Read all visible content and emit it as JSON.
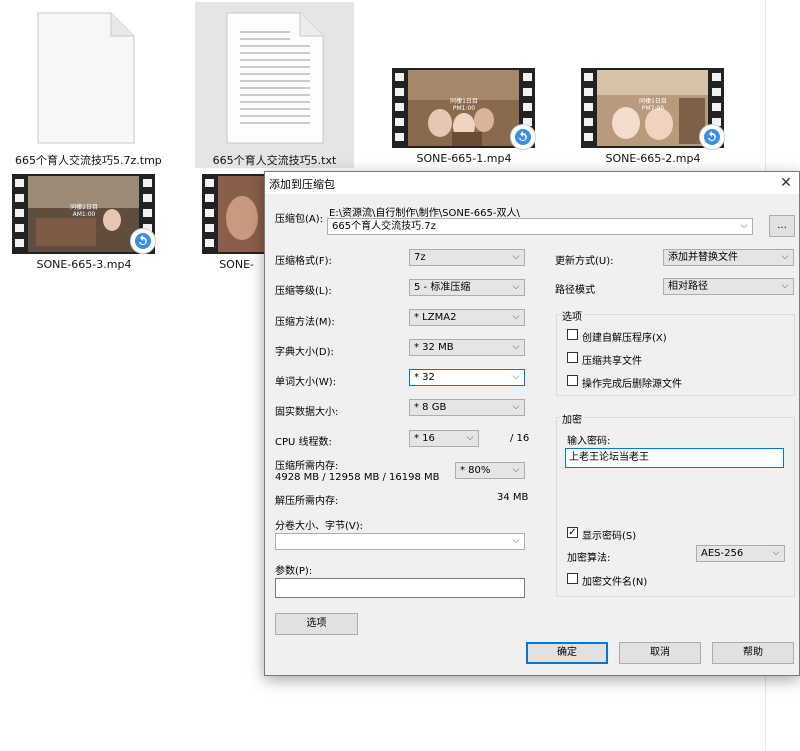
{
  "explorer": {
    "files": [
      {
        "name": "665个育人交流技巧5.7z.tmp",
        "type": "doc-blank"
      },
      {
        "name": "665个育人交流技巧5.txt",
        "type": "doc-lines"
      },
      {
        "name": "SONE-665-1.mp4",
        "type": "video",
        "overlay": "同棲1日目 PM1:00"
      },
      {
        "name": "SONE-665-2.mp4",
        "type": "video",
        "overlay": "同棲1日目 PM7:00"
      },
      {
        "name": "SONE-665-3.mp4",
        "type": "video",
        "overlay": "同棲2日目 AM1:00"
      },
      {
        "name": "SONE-",
        "type": "video-partial"
      }
    ]
  },
  "dialog": {
    "title": "添加到压缩包",
    "archive_label": "压缩包(A):",
    "archive_path": "E:\\资源流\\自行制作\\制作\\SONE-665-双人\\",
    "archive_name": "665个育人交流技巧.7z",
    "browse_label": "...",
    "format_label": "压缩格式(F):",
    "format_value": "7z",
    "level_label": "压缩等级(L):",
    "level_value": "5 - 标准压缩",
    "method_label": "压缩方法(M):",
    "method_value": "* LZMA2",
    "dict_label": "字典大小(D):",
    "dict_value": "* 32 MB",
    "word_label": "单词大小(W):",
    "word_value": "* 32",
    "solid_label": "固实数据大小:",
    "solid_value": "* 8 GB",
    "cpu_label": "CPU 线程数:",
    "cpu_value": "* 16",
    "cpu_total": "/ 16",
    "mem_label": "压缩所需内存:",
    "mem_detail": "4928 MB / 12958 MB / 16198 MB",
    "mem_value": "* 80%",
    "decomp_label": "解压所需内存:",
    "decomp_value": "34 MB",
    "split_label": "分卷大小、字节(V):",
    "split_value": "",
    "params_label": "参数(P):",
    "params_value": "",
    "options_button": "选项",
    "update_label": "更新方式(U):",
    "update_value": "添加并替换文件",
    "path_label": "路径模式",
    "path_value": "相对路径",
    "options_group": "选项",
    "opt_sfx": "创建自解压程序(X)",
    "opt_shared": "压缩共享文件",
    "opt_delete": "操作完成后删除源文件",
    "encrypt_group": "加密",
    "password_label": "输入密码:",
    "password_value": "上老王论坛当老王",
    "show_password": "显示密码(S)",
    "enc_method_label": "加密算法:",
    "enc_method_value": "AES-256",
    "encrypt_names": "加密文件名(N)",
    "ok": "确定",
    "cancel": "取消",
    "help": "帮助"
  },
  "colors": {
    "accent": "#0078d7",
    "dialog_bg": "#f0f0f0",
    "selected_bg": "#e5e5e5"
  }
}
